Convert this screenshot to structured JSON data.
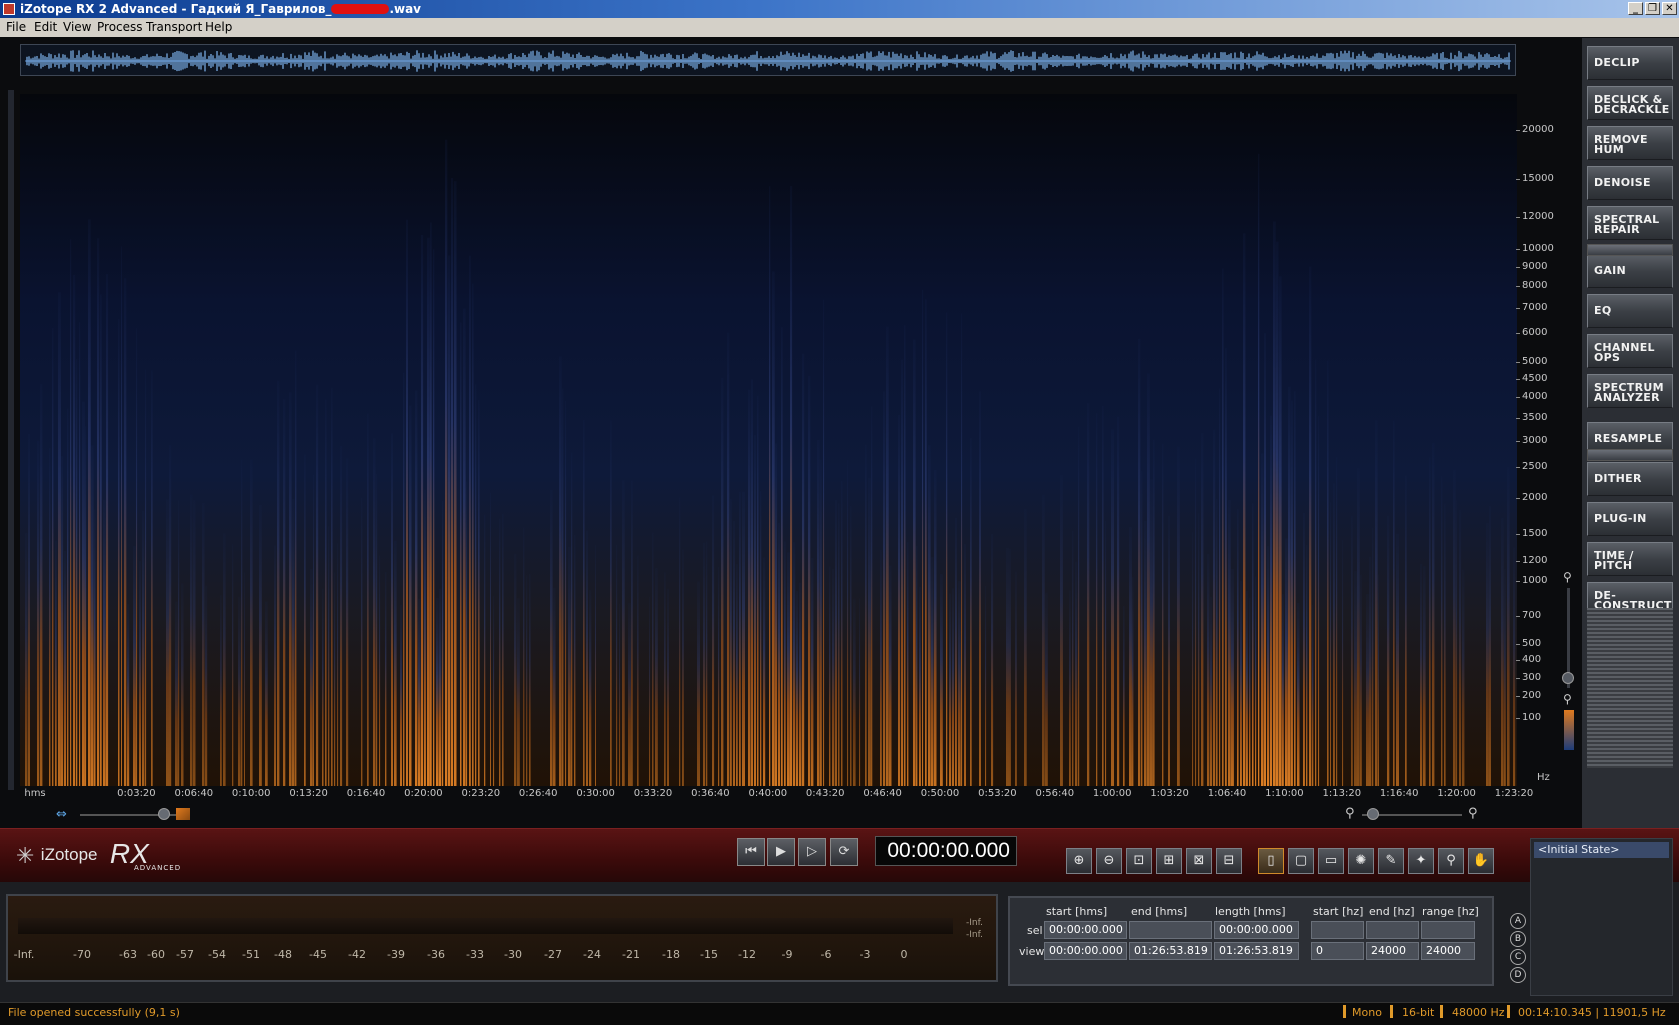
{
  "window": {
    "title": "iZotope RX 2 Advanced - Гадкий Я_Гаврилов_",
    "title_suffix": ".wav",
    "buttons": [
      "minimize",
      "restore",
      "close"
    ]
  },
  "menu": [
    "File",
    "Edit",
    "View",
    "Process",
    "Transport",
    "Help"
  ],
  "modules": [
    {
      "label": "DECLIP"
    },
    {
      "label": "DECLICK &\nDECRACKLE"
    },
    {
      "label": "REMOVE\nHUM"
    },
    {
      "label": "DENOISE"
    },
    {
      "label": "SPECTRAL\nREPAIR"
    },
    {
      "label": "GAIN"
    },
    {
      "label": "EQ"
    },
    {
      "label": "CHANNEL\nOPS"
    },
    {
      "label": "SPECTRUM\nANALYZER"
    },
    {
      "label": "RESAMPLE"
    },
    {
      "label": "DITHER"
    },
    {
      "label": "PLUG-IN"
    },
    {
      "label": "TIME /\nPITCH"
    },
    {
      "label": "DE-\nCONSTRUCT"
    }
  ],
  "freq_axis": {
    "labels": [
      "20000",
      "15000",
      "12000",
      "10000",
      "9000",
      "8000",
      "7000",
      "6000",
      "5000",
      "4500",
      "4000",
      "3500",
      "3000",
      "2500",
      "2000",
      "1500",
      "1200",
      "1000",
      "700",
      "500",
      "400",
      "300",
      "200",
      "100"
    ],
    "unit": "Hz"
  },
  "time_axis": {
    "labels": [
      "hms",
      "0:03:20",
      "0:06:40",
      "0:10:00",
      "0:13:20",
      "0:16:40",
      "0:20:00",
      "0:23:20",
      "0:26:40",
      "0:30:00",
      "0:33:20",
      "0:36:40",
      "0:40:00",
      "0:43:20",
      "0:46:40",
      "0:50:00",
      "0:53:20",
      "0:56:40",
      "1:00:00",
      "1:03:20",
      "1:06:40",
      "1:10:00",
      "1:13:20",
      "1:16:40",
      "1:20:00",
      "1:23:20"
    ]
  },
  "logo": {
    "brand": "iZotope",
    "product": "RX",
    "edition": "ADVANCED"
  },
  "transport": {
    "timecode": "00:00:00.000",
    "buttons": [
      "skip-back-icon",
      "play-icon",
      "play-selection-icon",
      "loop-icon"
    ]
  },
  "tools": [
    "zoom-in-icon",
    "zoom-out-icon",
    "zoom-fit-icon",
    "zoom-selection-icon",
    "zoom-time-icon",
    "zoom-freq-icon",
    "time-select-icon",
    "rect-select-icon",
    "freq-select-icon",
    "lasso-icon",
    "brush-icon",
    "magic-wand-icon",
    "zoom-tool-icon",
    "hand-icon"
  ],
  "meter": {
    "scale": [
      "-Inf.",
      "-70",
      "-63",
      "-60",
      "-57",
      "-54",
      "-51",
      "-48",
      "-45",
      "-42",
      "-39",
      "-36",
      "-33",
      "-30",
      "-27",
      "-24",
      "-21",
      "-18",
      "-15",
      "-12",
      "-9",
      "-6",
      "-3",
      "0"
    ],
    "right_labels": [
      "-Inf.",
      "-Inf."
    ]
  },
  "selection": {
    "headers": [
      "start [hms]",
      "end [hms]",
      "length [hms]",
      "start [hz]",
      "end [hz]",
      "range [hz]"
    ],
    "rows": [
      {
        "label": "sel",
        "cells": [
          "00:00:00.000",
          "",
          "00:00:00.000",
          "",
          "",
          ""
        ]
      },
      {
        "label": "view",
        "cells": [
          "00:00:00.000",
          "01:26:53.819",
          "01:26:53.819",
          "0",
          "24000",
          "24000"
        ]
      }
    ]
  },
  "compare_buttons": [
    "A",
    "B",
    "C",
    "D"
  ],
  "history": {
    "items": [
      "<Initial State>"
    ]
  },
  "status": {
    "message": "File opened successfully (9,1 s)",
    "channels": "Mono",
    "bit_depth": "16-bit",
    "sample_rate": "48000 Hz",
    "cursor": "00:14:10.345 | 11901,5 Hz"
  },
  "colors": {
    "accent": "#e09a2a",
    "spectro_low": "#e07a1e",
    "spectro_high": "#1d3c7a",
    "transport_bg": "#4a1010"
  }
}
